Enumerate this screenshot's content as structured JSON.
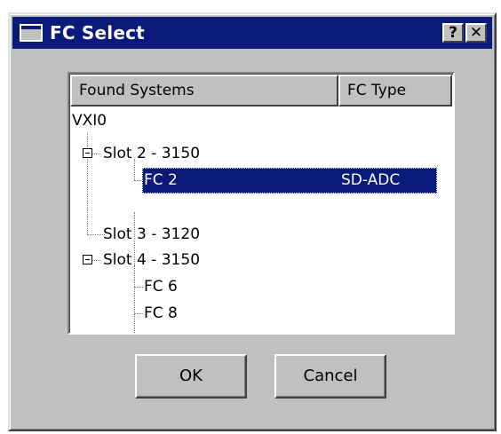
{
  "window": {
    "title": "FC Select",
    "help_label": "?",
    "close_label": "✕"
  },
  "list": {
    "columns": [
      "Found Systems",
      "FC Type"
    ],
    "rows": [
      {
        "label": "VXI0",
        "type": ""
      },
      {
        "label": "Slot 2 - 3150",
        "type": ""
      },
      {
        "label": "FC 2",
        "type": "SD-ADC",
        "selected": true
      },
      {
        "label": "Slot 3 - 3120",
        "type": ""
      },
      {
        "label": "Slot 4 - 3150",
        "type": ""
      },
      {
        "label": "FC 6",
        "type": ""
      },
      {
        "label": "FC 8",
        "type": ""
      }
    ]
  },
  "buttons": {
    "ok": "OK",
    "cancel": "Cancel"
  },
  "colors": {
    "titlebar": "#0a1a7a",
    "face": "#c0c0c0",
    "selection": "#0a1a7a"
  }
}
